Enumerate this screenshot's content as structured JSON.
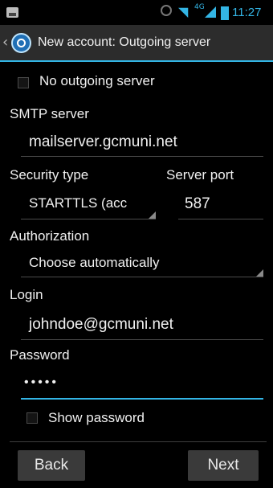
{
  "status_bar": {
    "time": "11:27",
    "network": "4G",
    "icons": [
      "photo-icon",
      "alarm-icon",
      "wifi-icon",
      "signal-icon",
      "battery-icon"
    ],
    "accent_color": "#33b5e5"
  },
  "action_bar": {
    "title": "New account: Outgoing server",
    "up_icon": "‹"
  },
  "no_outgoing": {
    "label": "No outgoing server",
    "checked": false
  },
  "smtp": {
    "label": "SMTP server",
    "value": "mailserver.gcmuni.net"
  },
  "security": {
    "label": "Security type",
    "value": "STARTTLS (acc"
  },
  "port": {
    "label": "Server port",
    "value": "587"
  },
  "authorization": {
    "label": "Authorization",
    "value": "Choose automatically"
  },
  "login": {
    "label": "Login",
    "value": "johndoe@gcmuni.net"
  },
  "password": {
    "label": "Password",
    "value": "•••••"
  },
  "show_password": {
    "label": "Show password",
    "checked": false
  },
  "buttons": {
    "back": "Back",
    "next": "Next"
  }
}
